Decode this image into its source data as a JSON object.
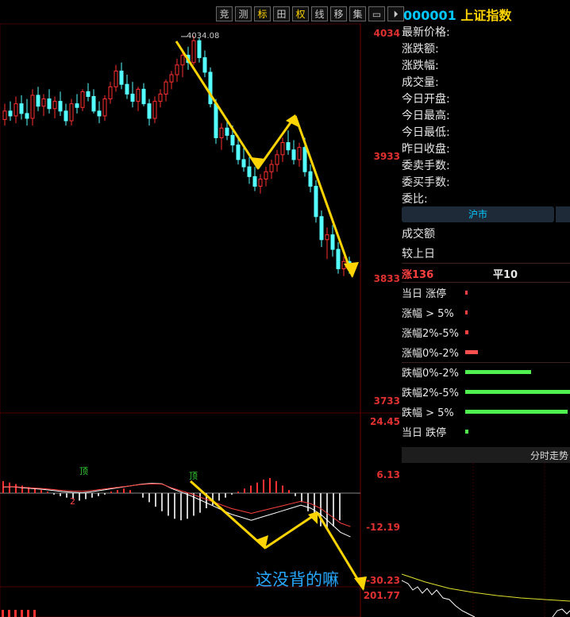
{
  "toolbar": [
    "竞",
    "测",
    "标",
    "田",
    "权",
    "线",
    "移",
    "集",
    "▭",
    "⏵"
  ],
  "toolbar_active": [
    "标",
    "权"
  ],
  "axis": {
    "price_ticks": [
      "4034",
      "3933",
      "3833",
      "3733"
    ],
    "macd_ticks": [
      "24.45",
      "6.13",
      "-12.19",
      "-30.23"
    ],
    "volume_tick": "201.77"
  },
  "high_label": "4034.08",
  "annotation_note": "这没背的嘛",
  "macd_markers": [
    "顶",
    "顶",
    "2"
  ],
  "quote": {
    "code": "000001",
    "name": "上证指数",
    "fields": [
      "最新价格:",
      "涨跌额:",
      "涨跌幅:",
      "成交量:",
      "今日开盘:",
      "今日最高:",
      "今日最低:",
      "昨日收盘:",
      "委卖手数:",
      "委买手数:",
      "委比:"
    ]
  },
  "market": {
    "tab": "沪市",
    "rows": [
      "成交额",
      "较上日"
    ],
    "up_count": "涨136",
    "flat_count": "平10"
  },
  "breadth": [
    {
      "label": "当日 涨停",
      "color": "#ff4040",
      "value": 0.01
    },
    {
      "label": "涨幅 > 5%",
      "color": "#ff4040",
      "value": 0.01
    },
    {
      "label": "涨幅2%-5%",
      "color": "#ff4040",
      "value": 0.03
    },
    {
      "label": "涨幅0%-2%",
      "color": "#ff5050",
      "value": 0.12
    },
    {
      "label": "跌幅0%-2%",
      "color": "#50f050",
      "value": 0.63
    },
    {
      "label": "跌幅2%-5%",
      "color": "#50f050",
      "value": 1.0
    },
    {
      "label": "跌幅 > 5%",
      "color": "#50f050",
      "value": 0.98
    },
    {
      "label": "当日 跌停",
      "color": "#50f050",
      "value": 0.03
    }
  ],
  "fenshi_label": "分时走势",
  "colors": {
    "up": "#ff3030",
    "down": "#54ffff",
    "arrow": "#ffd400",
    "axis": "#e03030"
  },
  "chart_data": {
    "type": "candlestick",
    "y_range": [
      3733,
      4034.08
    ],
    "ohlc": [
      [
        3965,
        3978,
        3960,
        3972
      ],
      [
        3972,
        3980,
        3964,
        3968
      ],
      [
        3968,
        3984,
        3962,
        3978
      ],
      [
        3978,
        3985,
        3965,
        3970
      ],
      [
        3970,
        3982,
        3960,
        3966
      ],
      [
        3966,
        3990,
        3960,
        3985
      ],
      [
        3985,
        3992,
        3972,
        3976
      ],
      [
        3976,
        3986,
        3968,
        3982
      ],
      [
        3982,
        3990,
        3970,
        3974
      ],
      [
        3974,
        3984,
        3966,
        3980
      ],
      [
        3980,
        3988,
        3968,
        3972
      ],
      [
        3972,
        3978,
        3960,
        3964
      ],
      [
        3964,
        3982,
        3960,
        3978
      ],
      [
        3978,
        3986,
        3970,
        3975
      ],
      [
        3975,
        3990,
        3972,
        3988
      ],
      [
        3988,
        3995,
        3980,
        3984
      ],
      [
        3984,
        3990,
        3970,
        3972
      ],
      [
        3972,
        3980,
        3962,
        3968
      ],
      [
        3968,
        3985,
        3964,
        3982
      ],
      [
        3982,
        3996,
        3978,
        3992
      ],
      [
        3992,
        4010,
        3988,
        4005
      ],
      [
        4005,
        4012,
        3990,
        3994
      ],
      [
        3994,
        4002,
        3982,
        3986
      ],
      [
        3986,
        3996,
        3975,
        3980
      ],
      [
        3980,
        3992,
        3972,
        3990
      ],
      [
        3990,
        3995,
        3976,
        3978
      ],
      [
        3978,
        3982,
        3960,
        3966
      ],
      [
        3966,
        3984,
        3962,
        3980
      ],
      [
        3980,
        3990,
        3975,
        3986
      ],
      [
        3986,
        3998,
        3980,
        3996
      ],
      [
        3996,
        4005,
        3990,
        4002
      ],
      [
        4002,
        4015,
        3996,
        4010
      ],
      [
        4010,
        4022,
        4000,
        4018
      ],
      [
        4018,
        4025,
        4006,
        4012
      ],
      [
        4012,
        4034.08,
        4010,
        4030
      ],
      [
        4030,
        4032,
        4012,
        4016
      ],
      [
        4016,
        4022,
        4000,
        4004
      ],
      [
        4004,
        4008,
        3975,
        3978
      ],
      [
        3978,
        3982,
        3945,
        3950
      ],
      [
        3950,
        3962,
        3940,
        3958
      ],
      [
        3958,
        3966,
        3948,
        3952
      ],
      [
        3952,
        3960,
        3938,
        3944
      ],
      [
        3944,
        3952,
        3928,
        3932
      ],
      [
        3932,
        3942,
        3922,
        3926
      ],
      [
        3926,
        3934,
        3912,
        3918
      ],
      [
        3918,
        3926,
        3906,
        3910
      ],
      [
        3910,
        3920,
        3904,
        3916
      ],
      [
        3916,
        3926,
        3910,
        3922
      ],
      [
        3922,
        3932,
        3916,
        3928
      ],
      [
        3928,
        3940,
        3922,
        3936
      ],
      [
        3936,
        3950,
        3930,
        3946
      ],
      [
        3946,
        3956,
        3936,
        3940
      ],
      [
        3940,
        3948,
        3928,
        3932
      ],
      [
        3932,
        3946,
        3926,
        3942
      ],
      [
        3942,
        3950,
        3918,
        3922
      ],
      [
        3922,
        3928,
        3905,
        3910
      ],
      [
        3910,
        3915,
        3880,
        3885
      ],
      [
        3885,
        3890,
        3860,
        3866
      ],
      [
        3866,
        3876,
        3850,
        3870
      ],
      [
        3870,
        3878,
        3852,
        3858
      ],
      [
        3858,
        3864,
        3838,
        3842
      ],
      [
        3842,
        3852,
        3836,
        3848
      ],
      [
        3848,
        3852,
        3838,
        3844
      ]
    ],
    "arrows_price": [
      [
        4034,
        0
      ],
      [
        3945,
        13
      ],
      [
        3975,
        20
      ],
      [
        3840,
        29
      ]
    ],
    "macd_dif": [
      4,
      4.2,
      3.5,
      3,
      2.5,
      1.8,
      1,
      0.5,
      0.2,
      1,
      2,
      3,
      4,
      5,
      6,
      6.5,
      6.2,
      3,
      0.5,
      -2,
      -5,
      -8,
      -11,
      -14,
      -16,
      -18,
      -16,
      -14,
      -12,
      -10,
      -8,
      -10,
      -14,
      -20,
      -26,
      -29
    ],
    "macd_hist": [
      8,
      7,
      6,
      5,
      4,
      3,
      2,
      1,
      -1,
      -2,
      -3,
      -4,
      -5,
      -4,
      -3,
      -2,
      -1,
      1,
      2,
      3,
      2,
      0,
      -3,
      -6,
      -9,
      -12,
      -15,
      -17,
      -18,
      -17,
      -15,
      -13,
      -10,
      -8,
      -5,
      -3,
      -1,
      1,
      3,
      5,
      7,
      9,
      10,
      8,
      5,
      2,
      -2,
      -6,
      -12,
      -18,
      -22,
      -24,
      -22,
      -18
    ]
  }
}
